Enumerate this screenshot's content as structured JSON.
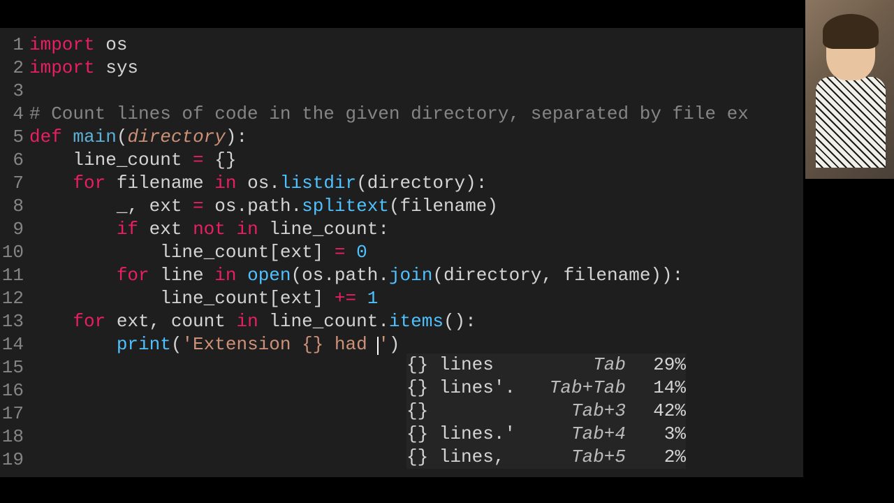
{
  "code_lines": [
    {
      "n": 1,
      "tokens": [
        [
          "kw",
          "import"
        ],
        [
          "ident",
          " os"
        ]
      ]
    },
    {
      "n": 2,
      "tokens": [
        [
          "kw",
          "import"
        ],
        [
          "ident",
          " sys"
        ]
      ]
    },
    {
      "n": 3,
      "tokens": [
        [
          "ident",
          ""
        ]
      ]
    },
    {
      "n": 4,
      "tokens": [
        [
          "cmt",
          "# Count lines of code in the given directory, separated by file ex"
        ]
      ]
    },
    {
      "n": 5,
      "tokens": [
        [
          "kw",
          "def "
        ],
        [
          "fname",
          "main"
        ],
        [
          "ident",
          "("
        ],
        [
          "param",
          "directory"
        ],
        [
          "ident",
          "):"
        ]
      ]
    },
    {
      "n": 6,
      "tokens": [
        [
          "ident",
          "    line_count "
        ],
        [
          "op",
          "="
        ],
        [
          "ident",
          " {}"
        ]
      ]
    },
    {
      "n": 7,
      "tokens": [
        [
          "ident",
          "    "
        ],
        [
          "kw",
          "for"
        ],
        [
          "ident",
          " filename "
        ],
        [
          "kw",
          "in"
        ],
        [
          "ident",
          " os."
        ],
        [
          "method",
          "listdir"
        ],
        [
          "ident",
          "(directory):"
        ]
      ]
    },
    {
      "n": 8,
      "tokens": [
        [
          "ident",
          "        _, ext "
        ],
        [
          "op",
          "="
        ],
        [
          "ident",
          " os.path."
        ],
        [
          "method",
          "splitext"
        ],
        [
          "ident",
          "(filename)"
        ]
      ]
    },
    {
      "n": 9,
      "tokens": [
        [
          "ident",
          "        "
        ],
        [
          "kw",
          "if"
        ],
        [
          "ident",
          " ext "
        ],
        [
          "kw",
          "not in"
        ],
        [
          "ident",
          " line_count:"
        ]
      ]
    },
    {
      "n": 10,
      "tokens": [
        [
          "ident",
          "            line_count[ext] "
        ],
        [
          "op",
          "="
        ],
        [
          "ident",
          " "
        ],
        [
          "num",
          "0"
        ]
      ]
    },
    {
      "n": 11,
      "tokens": [
        [
          "ident",
          "        "
        ],
        [
          "kw",
          "for"
        ],
        [
          "ident",
          " line "
        ],
        [
          "kw",
          "in"
        ],
        [
          "ident",
          " "
        ],
        [
          "method",
          "open"
        ],
        [
          "ident",
          "(os.path."
        ],
        [
          "method",
          "join"
        ],
        [
          "ident",
          "(directory, filename)):"
        ]
      ]
    },
    {
      "n": 12,
      "tokens": [
        [
          "ident",
          "            line_count[ext] "
        ],
        [
          "op",
          "+="
        ],
        [
          "ident",
          " "
        ],
        [
          "num",
          "1"
        ]
      ]
    },
    {
      "n": 13,
      "tokens": [
        [
          "ident",
          "    "
        ],
        [
          "kw",
          "for"
        ],
        [
          "ident",
          " ext, count "
        ],
        [
          "kw",
          "in"
        ],
        [
          "ident",
          " line_count."
        ],
        [
          "method",
          "items"
        ],
        [
          "ident",
          "():"
        ]
      ]
    },
    {
      "n": 14,
      "tokens": [
        [
          "ident",
          "        "
        ],
        [
          "method",
          "print"
        ],
        [
          "ident",
          "("
        ],
        [
          "str",
          "'Extension {} had "
        ],
        [
          "cursor",
          ""
        ],
        [
          "str",
          "'"
        ],
        [
          "ident",
          ")"
        ]
      ]
    },
    {
      "n": 15,
      "tokens": [
        [
          "ident",
          ""
        ]
      ]
    },
    {
      "n": 16,
      "tokens": [
        [
          "ident",
          ""
        ]
      ]
    },
    {
      "n": 17,
      "tokens": [
        [
          "ident",
          ""
        ]
      ]
    },
    {
      "n": 18,
      "tokens": [
        [
          "ident",
          ""
        ]
      ]
    },
    {
      "n": 19,
      "tokens": [
        [
          "ident",
          ""
        ]
      ]
    }
  ],
  "completions": [
    {
      "text": "{} lines",
      "key": "Tab",
      "pct": "29%"
    },
    {
      "text": "{} lines'.",
      "key": "Tab+Tab",
      "pct": "14%"
    },
    {
      "text": "{}",
      "key": "Tab+3",
      "pct": "42%"
    },
    {
      "text": "{} lines.'",
      "key": "Tab+4",
      "pct": "3%"
    },
    {
      "text": "{} lines,",
      "key": "Tab+5",
      "pct": "2%"
    }
  ]
}
